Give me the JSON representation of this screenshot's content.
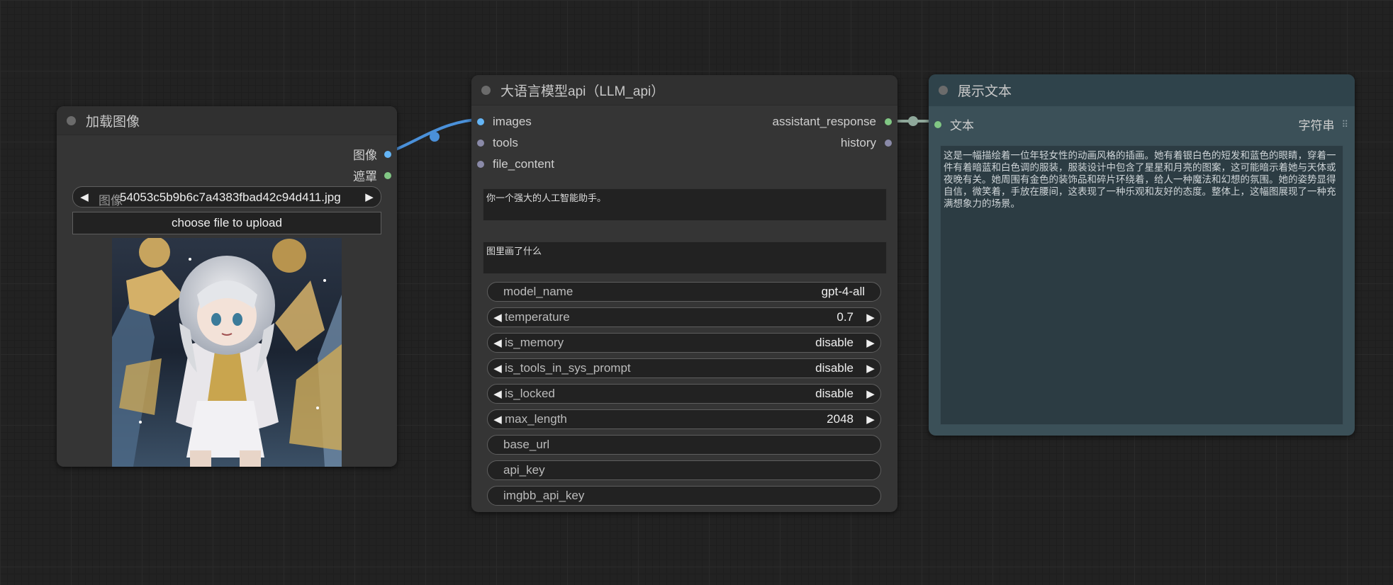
{
  "load_image_node": {
    "title": "加载图像",
    "outputs": [
      {
        "label": "图像",
        "color": "#64b5f6"
      },
      {
        "label": "遮罩",
        "color": "#81c784"
      }
    ],
    "image_widget": {
      "label": "图像",
      "value": "54053c5b9b6c7a4383fbad42c94d411.jpg"
    },
    "upload_button": "choose file to upload"
  },
  "llm_node": {
    "title": "大语言模型api（LLM_api）",
    "inputs": [
      {
        "label": "images",
        "color": "#64b5f6"
      },
      {
        "label": "tools",
        "color": "#8a8aa8"
      },
      {
        "label": "file_content",
        "color": "#8a8aa8"
      }
    ],
    "outputs": [
      {
        "label": "assistant_response",
        "color": "#81c784"
      },
      {
        "label": "history",
        "color": "#8a8aa8"
      }
    ],
    "system_prompt": "你一个强大的人工智能助手。",
    "user_prompt": "图里画了什么",
    "widgets": [
      {
        "label": "model_name",
        "value": "gpt-4-all",
        "arrows": false
      },
      {
        "label": "temperature",
        "value": "0.7",
        "arrows": true
      },
      {
        "label": "is_memory",
        "value": "disable",
        "arrows": true
      },
      {
        "label": "is_tools_in_sys_prompt",
        "value": "disable",
        "arrows": true
      },
      {
        "label": "is_locked",
        "value": "disable",
        "arrows": true
      },
      {
        "label": "max_length",
        "value": "2048",
        "arrows": true
      },
      {
        "label": "base_url",
        "value": "",
        "arrows": false
      },
      {
        "label": "api_key",
        "value": "",
        "arrows": false
      },
      {
        "label": "imgbb_api_key",
        "value": "",
        "arrows": false
      }
    ]
  },
  "show_text_node": {
    "title": "展示文本",
    "input_label": "文本",
    "type_label": "字符串",
    "text": "这是一幅描绘着一位年轻女性的动画风格的插画。她有着银白色的短发和蓝色的眼睛，穿着一件有着暗蓝和白色调的服装，服装设计中包含了星星和月亮的图案，这可能暗示着她与天体或夜晚有关。她周围有金色的装饰品和碎片环绕着，给人一种魔法和幻想的氛围。她的姿势显得自信，微笑着，手放在腰间，这表现了一种乐观和友好的态度。整体上，这幅图展现了一种充满想象力的场景。"
  }
}
